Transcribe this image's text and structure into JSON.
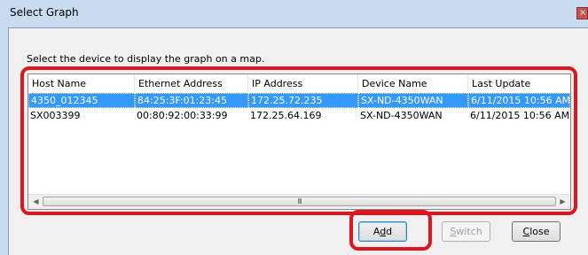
{
  "window": {
    "title": "Select Graph",
    "close_glyph": "×"
  },
  "instruction": "Select the device to display the graph on a map.",
  "table": {
    "columns": [
      "Host Name",
      "Ethernet Address",
      "IP Address",
      "Device Name",
      "Last Update"
    ],
    "rows": [
      {
        "selected": true,
        "cells": [
          "4350_012345",
          "84:25:3F:01:23:45",
          "172.25.72.235",
          "SX-ND-4350WAN",
          "6/11/2015 10:56 AM"
        ]
      },
      {
        "selected": false,
        "cells": [
          "SX003399",
          "00:80:92:00:33:99",
          "172.25.64.169",
          "SX-ND-4350WAN",
          "6/11/2015 10:56 AM"
        ]
      }
    ]
  },
  "scrollbar": {
    "left_arrow": "◀",
    "right_arrow": "▶",
    "grip": "III"
  },
  "buttons": {
    "add": {
      "label": "Add",
      "mnemonic_pre": "A",
      "mnemonic": "d",
      "mnemonic_post": "d"
    },
    "switch": {
      "label": "Switch",
      "mnemonic_pre": "",
      "mnemonic": "S",
      "mnemonic_post": "witch"
    },
    "close": {
      "label": "Close",
      "mnemonic_pre": "",
      "mnemonic": "C",
      "mnemonic_post": "lose"
    }
  },
  "colors": {
    "titlebar": "#c9dcef",
    "selection": "#3399ff",
    "highlight": "#e0161f"
  },
  "icons": [
    "close-icon",
    "scroll-left-icon",
    "scroll-right-icon"
  ]
}
